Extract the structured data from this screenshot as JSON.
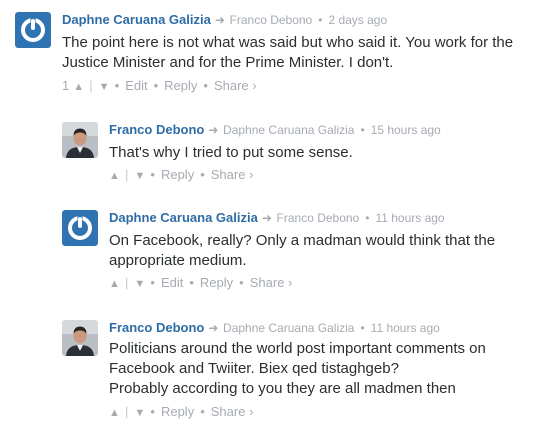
{
  "comments": [
    {
      "author": "Daphne Caruana Galizia",
      "reply_to": "Franco Debono",
      "time": "2 days ago",
      "message_lines": [
        "The point here is not what was said but who said it. You work for the",
        "Justice Minister and for the Prime Minister. I don't."
      ],
      "vote_count": "1",
      "actions": {
        "edit": "Edit",
        "reply": "Reply",
        "share": "Share ›"
      },
      "avatar_icon": "power-logo-icon"
    },
    {
      "author": "Franco Debono",
      "reply_to": "Daphne Caruana Galizia",
      "time": "15 hours ago",
      "message_lines": [
        "That's why I tried to put some sense."
      ],
      "actions": {
        "reply": "Reply",
        "share": "Share ›"
      },
      "avatar_icon": "user-photo-icon"
    },
    {
      "author": "Daphne Caruana Galizia",
      "reply_to": "Franco Debono",
      "time": "11 hours ago",
      "message_lines": [
        "On Facebook, really? Only a madman would think that the",
        "appropriate medium."
      ],
      "actions": {
        "edit": "Edit",
        "reply": "Reply",
        "share": "Share ›"
      },
      "avatar_icon": "power-logo-icon"
    },
    {
      "author": "Franco Debono",
      "reply_to": "Daphne Caruana Galizia",
      "time": "11 hours ago",
      "message_lines": [
        "Politicians around the world post important comments on",
        "Facebook and Twiiter. Biex qed tistaghgeb?",
        "Probably according to you they are all madmen then"
      ],
      "actions": {
        "reply": "Reply",
        "share": "Share ›"
      },
      "avatar_icon": "user-photo-icon"
    }
  ],
  "glyphs": {
    "arrow": "➜",
    "upvote": "▲",
    "downvote": "▼",
    "dot": "•"
  },
  "colors": {
    "author": "#2e6ca5",
    "meta": "#a6abb2",
    "logo_bg": "#2f73b3",
    "text": "#2a2e2e"
  }
}
